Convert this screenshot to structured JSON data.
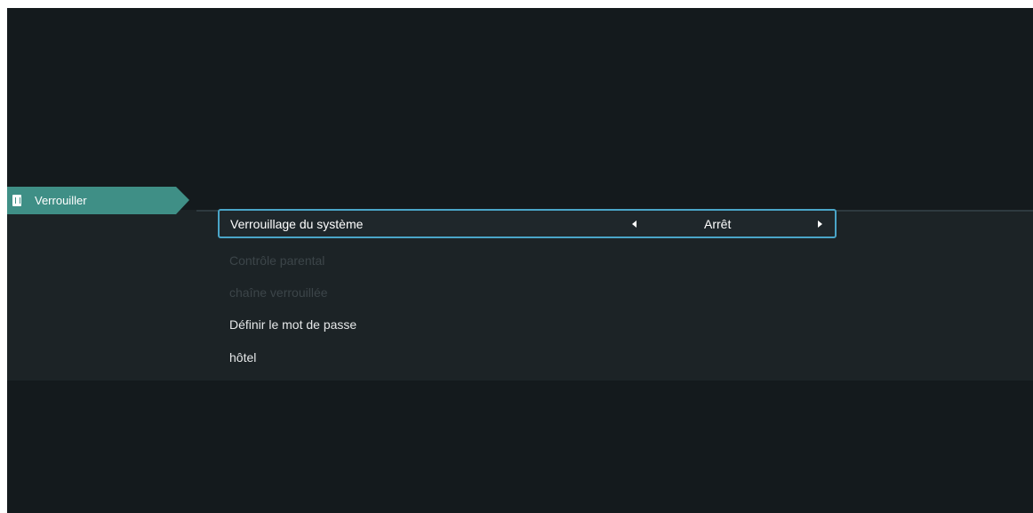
{
  "category": {
    "label": "Verrouiller",
    "icon": "lock-icon",
    "accent_color": "#3f8f86"
  },
  "menu": {
    "selected": {
      "label": "Verrouillage du système",
      "value": "Arrêt",
      "left_arrow": "chevron-left-icon",
      "right_arrow": "chevron-right-icon",
      "focus_color": "#4aa5c8"
    },
    "items": [
      {
        "label": "Contrôle parental",
        "enabled": false
      },
      {
        "label": "chaîne verrouillée",
        "enabled": false
      },
      {
        "label": "Définir le mot de passe",
        "enabled": true
      },
      {
        "label": "hôtel",
        "enabled": true
      }
    ]
  }
}
